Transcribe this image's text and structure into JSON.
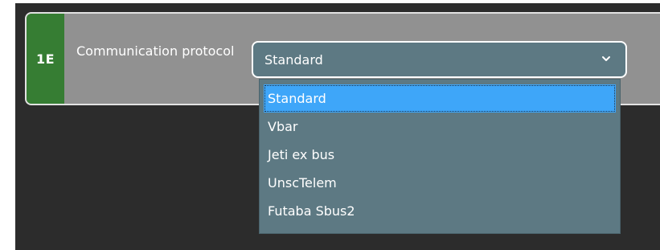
{
  "setting": {
    "id": "1E",
    "label": "Communication protocol",
    "selected_value": "Standard"
  },
  "dropdown": {
    "options": [
      {
        "label": "Standard",
        "selected": true
      },
      {
        "label": "Vbar",
        "selected": false
      },
      {
        "label": "Jeti ex bus",
        "selected": false
      },
      {
        "label": "UnscTelem",
        "selected": false
      },
      {
        "label": "Futaba Sbus2",
        "selected": false
      }
    ]
  },
  "colors": {
    "id_badge": "#367d33",
    "row_background": "#919191",
    "select_background": "#5d7983",
    "highlight": "#3ea6f9",
    "app_background": "#2c2c2c"
  },
  "icons": {
    "dropdown_toggle": "chevron-down-icon"
  }
}
